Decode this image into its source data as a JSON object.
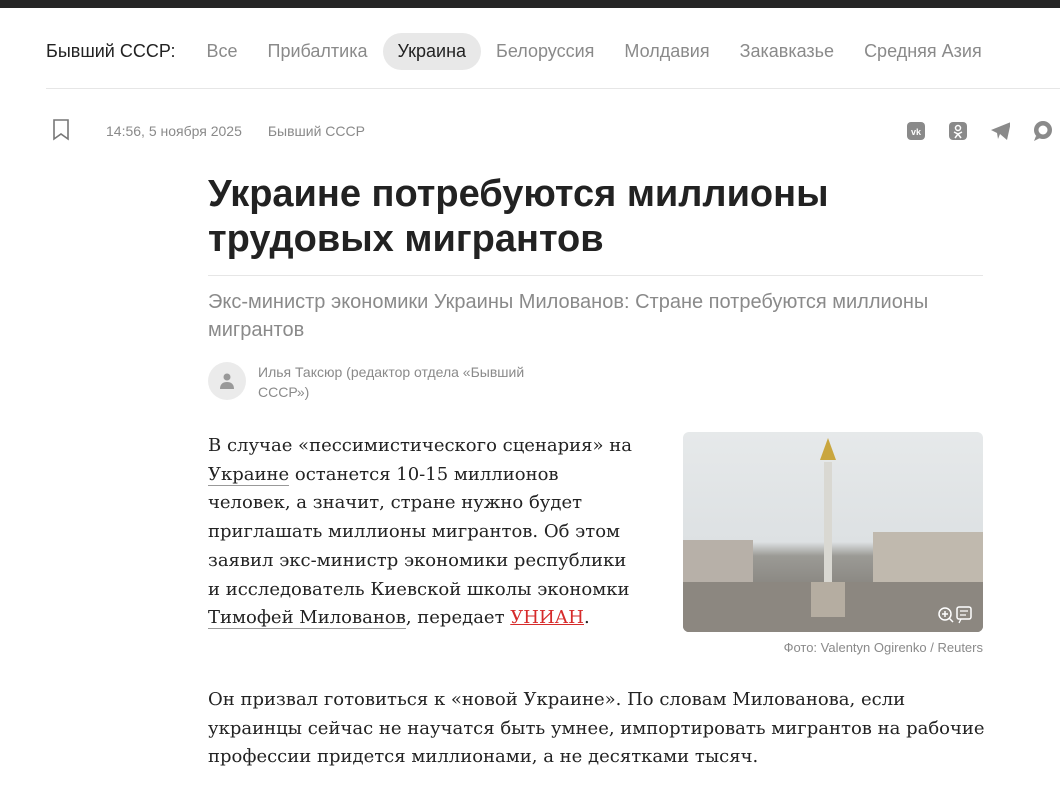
{
  "nav": {
    "label": "Бывший СССР:",
    "items": [
      "Все",
      "Прибалтика",
      "Украина",
      "Белоруссия",
      "Молдавия",
      "Закавказье",
      "Средняя Азия"
    ],
    "active": "Украина"
  },
  "meta": {
    "time": "14:56, 5 ноября 2025",
    "rubric": "Бывший СССР"
  },
  "share": [
    "vk-icon",
    "ok-icon",
    "telegram-icon",
    "chat-icon"
  ],
  "article": {
    "title": "Украине потребуются миллионы трудовых мигрантов",
    "subtitle": "Экс-министр экономики Украины Милованов: Стране потребуются миллионы мигрантов",
    "author": "Илья Таксюр (редактор отдела «Бывший СССР»)",
    "p1": {
      "a": "В случае «пессимистического сценария» на ",
      "link1": "Украине",
      "b": " останется 10-15 миллионов человек, а значит, стране нужно будет приглашать миллионы мигрантов. Об этом заявил экс-министр экономики республики и исследователь Киевской школы экономки ",
      "link2": "Тимофей Милованов",
      "c": ", передает ",
      "link3": "УНИАН",
      "d": "."
    },
    "p2": "Он призвал готовиться к «новой Украине». По словам Милованова, если украинцы сейчас не научатся быть умнее, импортировать мигрантов на рабочие профессии придется миллионами, а не десятками тысяч.",
    "photo_caption": "Фото: Valentyn Ogirenko / Reuters"
  }
}
